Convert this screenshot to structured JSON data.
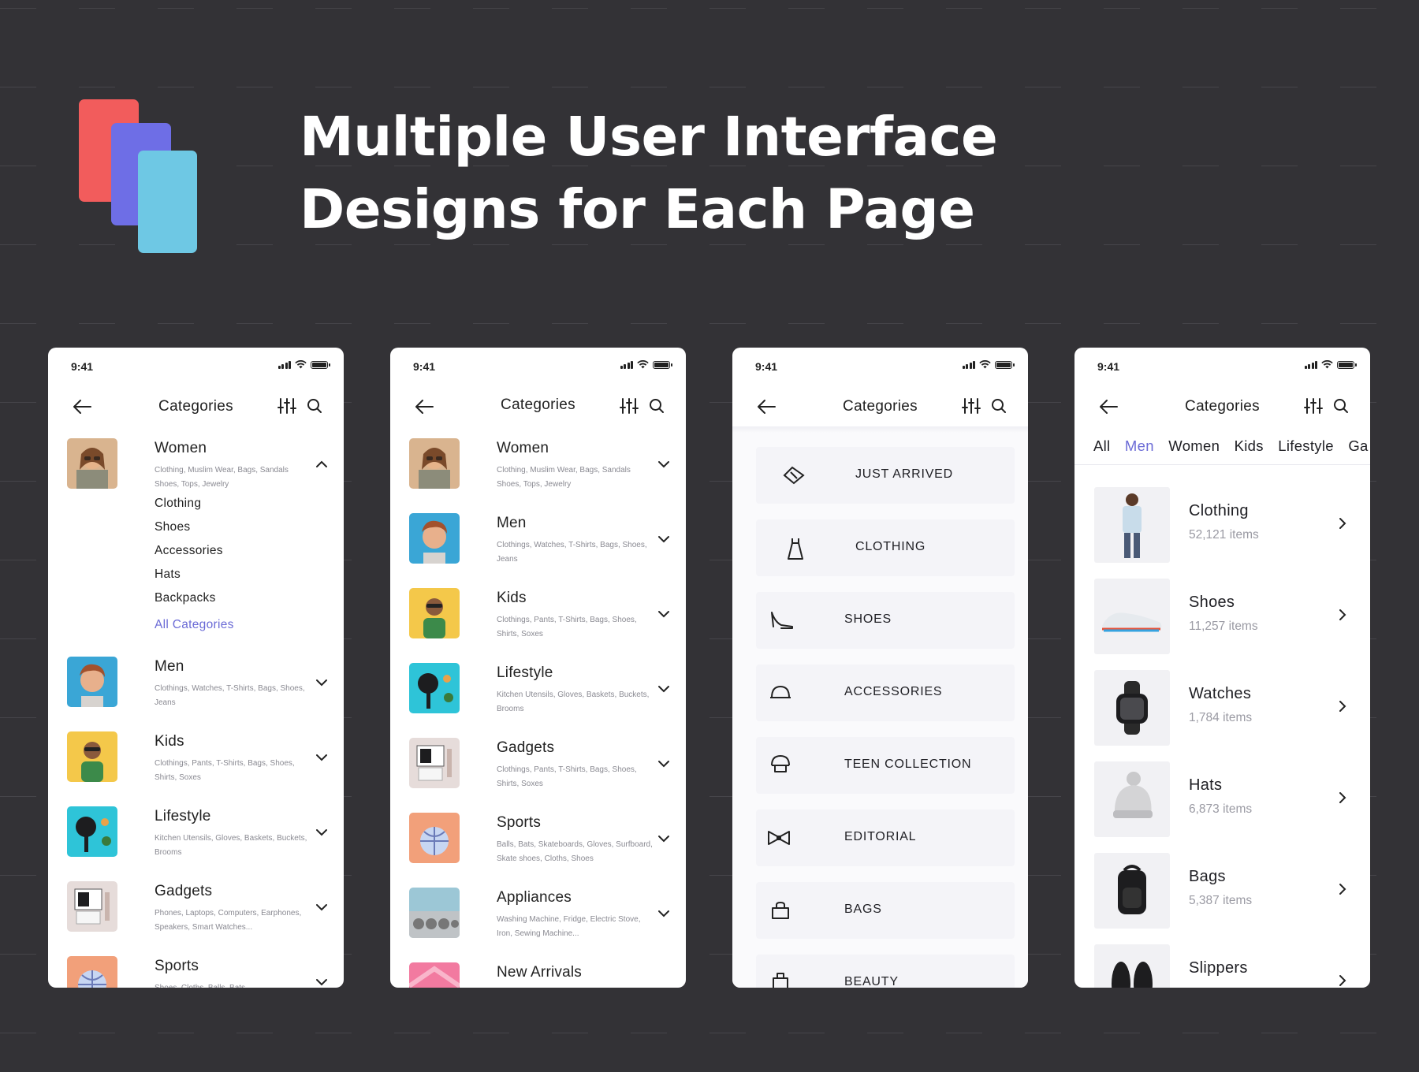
{
  "headline": {
    "line1": "Multiple User Interface",
    "line2": "Designs for Each Page"
  },
  "colors": {
    "background": "#333236",
    "accent": "#6b6bd6",
    "logo": [
      "#f25c5c",
      "#6e6ee6",
      "#6ec8e4"
    ]
  },
  "status": {
    "time": "9:41"
  },
  "nav": {
    "title": "Categories"
  },
  "phone1": {
    "expanded": {
      "name": "Women",
      "sub": "Clothing, Muslim Wear, Bags, Sandals Shoes, Tops, Jewelry",
      "items": [
        "Clothing",
        "Shoes",
        "Accessories",
        "Hats",
        "Backpacks"
      ],
      "all_label": "All Categories"
    },
    "rows": [
      {
        "name": "Men",
        "sub": "Clothings, Watches, T-Shirts, Bags, Shoes, Jeans"
      },
      {
        "name": "Kids",
        "sub": "Clothings, Pants, T-Shirts, Bags, Shoes, Shirts, Soxes"
      },
      {
        "name": "Lifestyle",
        "sub": "Kitchen Utensils, Gloves, Baskets, Buckets, Brooms"
      },
      {
        "name": "Gadgets",
        "sub": "Phones, Laptops, Computers, Earphones, Speakers, Smart Watches..."
      },
      {
        "name": "Sports",
        "sub": "Shoes, Cloths, Balls, Bats"
      }
    ]
  },
  "phone2": {
    "rows": [
      {
        "name": "Women",
        "sub": "Clothing, Muslim Wear, Bags, Sandals Shoes, Tops, Jewelry"
      },
      {
        "name": "Men",
        "sub": "Clothings, Watches, T-Shirts, Bags, Shoes, Jeans"
      },
      {
        "name": "Kids",
        "sub": "Clothings, Pants, T-Shirts, Bags, Shoes, Shirts, Soxes"
      },
      {
        "name": "Lifestyle",
        "sub": "Kitchen Utensils, Gloves, Baskets, Buckets, Brooms"
      },
      {
        "name": "Gadgets",
        "sub": "Clothings, Pants, T-Shirts, Bags, Shoes, Shirts, Soxes"
      },
      {
        "name": "Sports",
        "sub": "Balls, Bats, Skateboards, Gloves, Surfboard, Skate shoes, Cloths, Shoes"
      },
      {
        "name": "Appliances",
        "sub": "Washing Machine, Fridge, Electric Stove, Iron, Sewing Machine..."
      },
      {
        "name": "New Arrivals",
        "sub": ""
      }
    ]
  },
  "phone3": {
    "tiles": [
      {
        "label": "JUST ARRIVED",
        "icon": "tag-icon"
      },
      {
        "label": "CLOTHING",
        "icon": "dress-icon"
      },
      {
        "label": "SHOES",
        "icon": "high-heel-icon"
      },
      {
        "label": "ACCESSORIES",
        "icon": "hat-icon"
      },
      {
        "label": "TEEN COLLECTION",
        "icon": "cap-icon"
      },
      {
        "label": "EDITORIAL",
        "icon": "bow-tie-icon"
      },
      {
        "label": "BAGS",
        "icon": "bag-icon"
      },
      {
        "label": "BEAUTY",
        "icon": "cosmetics-icon"
      }
    ]
  },
  "phone4": {
    "tabs": [
      "All",
      "Men",
      "Women",
      "Kids",
      "Lifestyle",
      "Ga"
    ],
    "products": [
      {
        "name": "Clothing",
        "count": "52,121 items"
      },
      {
        "name": "Shoes",
        "count": "11,257 items"
      },
      {
        "name": "Watches",
        "count": "1,784 items"
      },
      {
        "name": "Hats",
        "count": "6,873 items"
      },
      {
        "name": "Bags",
        "count": "5,387 items"
      },
      {
        "name": "Slippers",
        "count": ""
      }
    ]
  }
}
